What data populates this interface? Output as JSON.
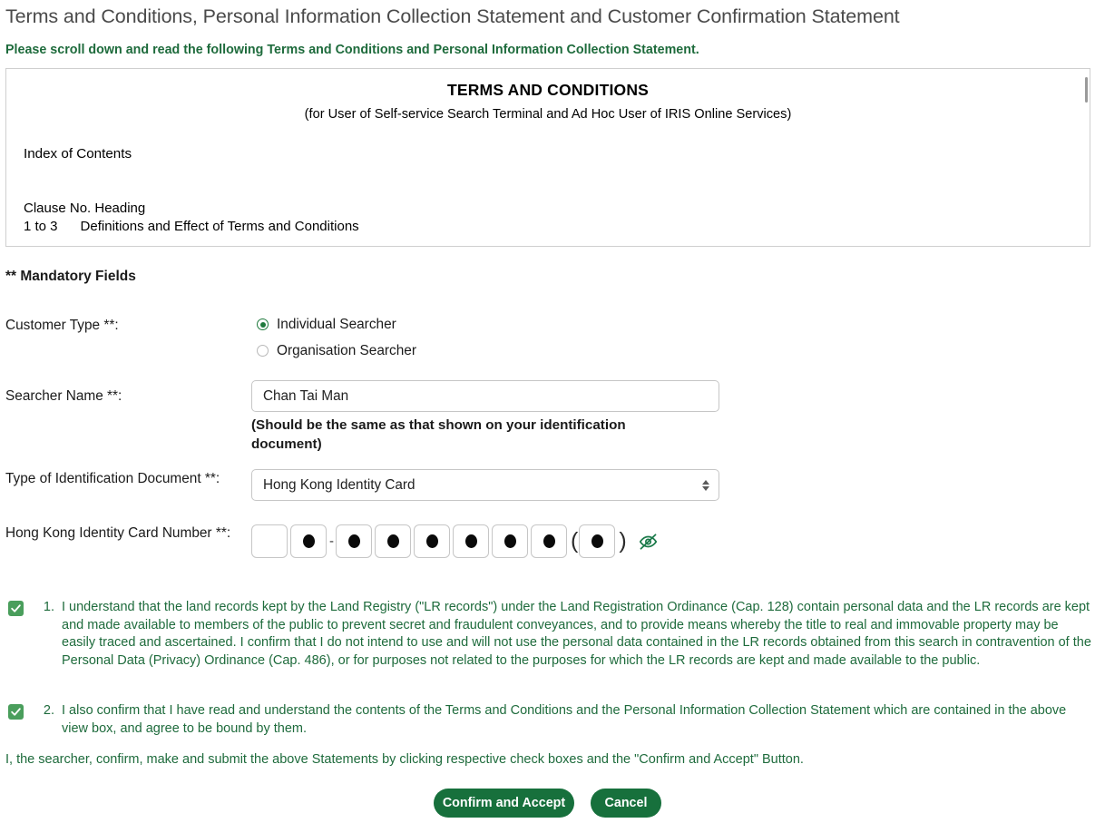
{
  "header": {
    "title": "Terms and Conditions, Personal Information Collection Statement and Customer Confirmation Statement",
    "scroll_note": "Please scroll down and read the following Terms and Conditions and Personal Information Collection Statement."
  },
  "terms": {
    "title": "TERMS AND CONDITIONS",
    "subtitle": "(for User of Self-service Search Terminal and Ad Hoc User of IRIS Online Services)",
    "index_heading": "Index of Contents",
    "table_header": "Clause No. Heading",
    "rows": [
      {
        "clause": "1 to 3",
        "heading": "Definitions and Effect of Terms and Conditions"
      }
    ]
  },
  "form": {
    "mandatory_note": "** Mandatory Fields",
    "customer_type": {
      "label": "Customer Type **:",
      "options": [
        {
          "label": "Individual Searcher",
          "selected": true
        },
        {
          "label": "Organisation Searcher",
          "selected": false
        }
      ]
    },
    "searcher_name": {
      "label": "Searcher Name **:",
      "value": "Chan Tai Man",
      "placeholder": "",
      "hint": "(Should be the same as that shown on your identification document)"
    },
    "id_type": {
      "label": "Type of Identification Document **:",
      "selected": "Hong Kong Identity Card"
    },
    "hkid": {
      "label": "Hong Kong Identity Card Number **:",
      "separator": "-",
      "paren_open": "(",
      "paren_close": ")",
      "cells": [
        {
          "masked": false
        },
        {
          "masked": true
        },
        {
          "masked": true
        },
        {
          "masked": true
        },
        {
          "masked": true
        },
        {
          "masked": true
        },
        {
          "masked": true
        },
        {
          "masked": true
        },
        {
          "masked": true
        }
      ],
      "toggle_icon": "eye-off-icon"
    }
  },
  "confirmations": [
    {
      "number": "1.",
      "checked": true,
      "text": "I understand that the land records kept by the Land Registry (\"LR records\") under the Land Registration Ordinance (Cap. 128) contain personal data and the LR records are kept and made available to members of the public to prevent secret and fraudulent conveyances, and to provide means whereby the title to real and immovable property may be easily traced and ascertained. I confirm that I do not intend to use and will not use the personal data contained in the LR records obtained from this search in contravention of the Personal Data (Privacy) Ordinance (Cap. 486), or for purposes not related to the purposes for which the LR records are kept and made available to the public."
    },
    {
      "number": "2.",
      "checked": true,
      "text": "I also confirm that I have read and understand the contents of the Terms and Conditions and the Personal Information Collection Statement which are contained in the above view box, and agree to be bound by them."
    }
  ],
  "closing_note": "I, the searcher, confirm, make and submit the above Statements by clicking respective check boxes and the \"Confirm and Accept\" Button.",
  "buttons": {
    "confirm": "Confirm and Accept",
    "cancel": "Cancel"
  },
  "colors": {
    "brand_green": "#17703c",
    "text_green": "#1e6b3c",
    "checkbox_green": "#4a9e5c",
    "border_grey": "#c6c6c6"
  }
}
